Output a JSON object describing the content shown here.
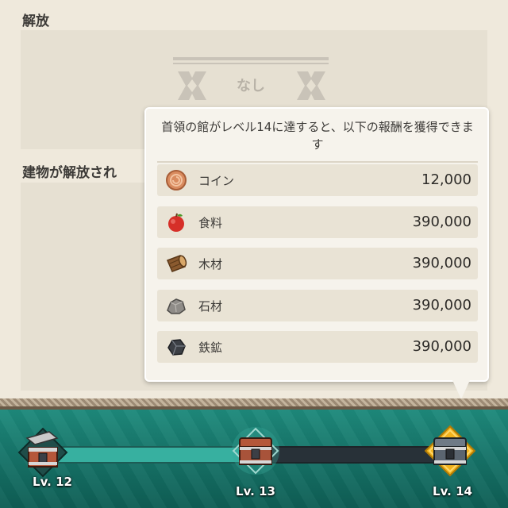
{
  "sections": {
    "unlock_title": "解放",
    "building_title": "建物が解放され",
    "none_label": "なし"
  },
  "tooltip": {
    "header": "首領の館がレベル14に達すると、以下の報酬を獲得できます",
    "rewards": [
      {
        "icon": "coin-icon",
        "name": "コイン",
        "value": "12,000"
      },
      {
        "icon": "food-apple-icon",
        "name": "食料",
        "value": "390,000"
      },
      {
        "icon": "wood-log-icon",
        "name": "木材",
        "value": "390,000"
      },
      {
        "icon": "stone-icon",
        "name": "石材",
        "value": "390,000"
      },
      {
        "icon": "iron-ore-icon",
        "name": "鉄鉱",
        "value": "390,000"
      }
    ]
  },
  "progress": {
    "levels": [
      {
        "label": "Lv. 12",
        "state": "opened"
      },
      {
        "label": "Lv. 13",
        "state": "current"
      },
      {
        "label": "Lv. 14",
        "state": "selected"
      }
    ],
    "colors": {
      "filled": "#37b0a0",
      "empty": "#283138",
      "selected_glow": "#f2b21c"
    }
  }
}
